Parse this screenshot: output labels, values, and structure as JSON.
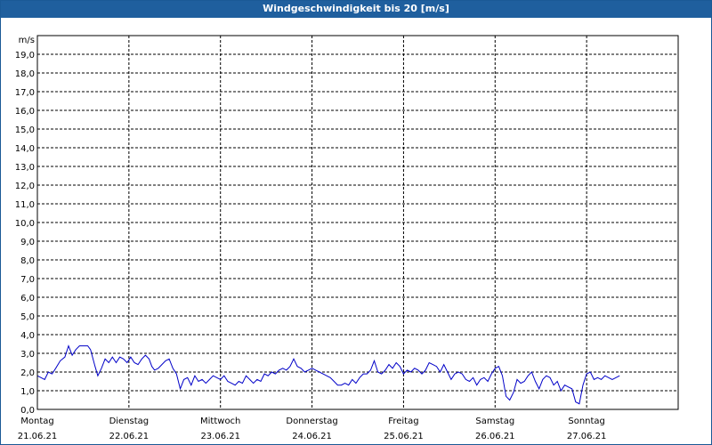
{
  "window": {
    "title": "Windgeschwindigkeit bis 20 [m/s]"
  },
  "colors": {
    "titlebar": "#1f5f9e",
    "series": "#0000c8",
    "grid": "#000000"
  },
  "chart_data": {
    "type": "line",
    "ylabel": "m/s",
    "ylim": [
      0,
      20
    ],
    "yticks": [
      "0,0",
      "1,0",
      "2,0",
      "3,0",
      "4,0",
      "5,0",
      "6,0",
      "7,0",
      "8,0",
      "9,0",
      "10,0",
      "11,0",
      "12,0",
      "13,0",
      "14,0",
      "15,0",
      "16,0",
      "17,0",
      "18,0",
      "19,0"
    ],
    "grid": true,
    "days": [
      {
        "name": "Montag",
        "date": "21.06.21"
      },
      {
        "name": "Dienstag",
        "date": "22.06.21"
      },
      {
        "name": "Mittwoch",
        "date": "23.06.21"
      },
      {
        "name": "Donnerstag",
        "date": "24.06.21"
      },
      {
        "name": "Freitag",
        "date": "25.06.21"
      },
      {
        "name": "Samstag",
        "date": "26.06.21"
      },
      {
        "name": "Sonntag",
        "date": "27.06.21"
      }
    ],
    "x_unit": "days since 21.06.21 00:00",
    "series": [
      {
        "values": [
          [
            0.0,
            1.8
          ],
          [
            0.04,
            1.7
          ],
          [
            0.08,
            1.6
          ],
          [
            0.12,
            2.0
          ],
          [
            0.16,
            1.9
          ],
          [
            0.2,
            2.2
          ],
          [
            0.25,
            2.6
          ],
          [
            0.3,
            2.8
          ],
          [
            0.34,
            3.4
          ],
          [
            0.38,
            2.9
          ],
          [
            0.42,
            3.2
          ],
          [
            0.46,
            3.4
          ],
          [
            0.5,
            3.4
          ],
          [
            0.55,
            3.4
          ],
          [
            0.58,
            3.2
          ],
          [
            0.63,
            2.3
          ],
          [
            0.66,
            1.8
          ],
          [
            0.7,
            2.2
          ],
          [
            0.74,
            2.7
          ],
          [
            0.78,
            2.5
          ],
          [
            0.82,
            2.8
          ],
          [
            0.86,
            2.5
          ],
          [
            0.9,
            2.8
          ],
          [
            0.94,
            2.7
          ],
          [
            0.98,
            2.5
          ],
          [
            1.02,
            2.8
          ],
          [
            1.06,
            2.5
          ],
          [
            1.1,
            2.4
          ],
          [
            1.14,
            2.7
          ],
          [
            1.18,
            2.9
          ],
          [
            1.22,
            2.7
          ],
          [
            1.25,
            2.3
          ],
          [
            1.28,
            2.1
          ],
          [
            1.32,
            2.2
          ],
          [
            1.36,
            2.4
          ],
          [
            1.4,
            2.6
          ],
          [
            1.44,
            2.7
          ],
          [
            1.48,
            2.2
          ],
          [
            1.52,
            1.9
          ],
          [
            1.56,
            1.1
          ],
          [
            1.6,
            1.6
          ],
          [
            1.64,
            1.7
          ],
          [
            1.68,
            1.3
          ],
          [
            1.72,
            1.8
          ],
          [
            1.76,
            1.5
          ],
          [
            1.8,
            1.6
          ],
          [
            1.84,
            1.4
          ],
          [
            1.88,
            1.6
          ],
          [
            1.92,
            1.8
          ],
          [
            1.96,
            1.7
          ],
          [
            2.0,
            1.6
          ],
          [
            2.04,
            1.8
          ],
          [
            2.08,
            1.5
          ],
          [
            2.12,
            1.4
          ],
          [
            2.16,
            1.3
          ],
          [
            2.2,
            1.5
          ],
          [
            2.24,
            1.4
          ],
          [
            2.28,
            1.8
          ],
          [
            2.32,
            1.6
          ],
          [
            2.36,
            1.4
          ],
          [
            2.4,
            1.6
          ],
          [
            2.44,
            1.5
          ],
          [
            2.48,
            1.9
          ],
          [
            2.52,
            1.8
          ],
          [
            2.56,
            2.0
          ],
          [
            2.6,
            1.9
          ],
          [
            2.64,
            2.1
          ],
          [
            2.68,
            2.2
          ],
          [
            2.72,
            2.1
          ],
          [
            2.76,
            2.3
          ],
          [
            2.8,
            2.7
          ],
          [
            2.84,
            2.3
          ],
          [
            2.88,
            2.2
          ],
          [
            2.92,
            2.0
          ],
          [
            2.96,
            2.1
          ],
          [
            3.0,
            2.2
          ],
          [
            3.04,
            2.1
          ],
          [
            3.08,
            2.0
          ],
          [
            3.12,
            1.9
          ],
          [
            3.16,
            1.8
          ],
          [
            3.2,
            1.7
          ],
          [
            3.24,
            1.5
          ],
          [
            3.28,
            1.3
          ],
          [
            3.32,
            1.3
          ],
          [
            3.36,
            1.4
          ],
          [
            3.4,
            1.3
          ],
          [
            3.44,
            1.6
          ],
          [
            3.48,
            1.4
          ],
          [
            3.52,
            1.7
          ],
          [
            3.56,
            1.9
          ],
          [
            3.6,
            1.9
          ],
          [
            3.64,
            2.1
          ],
          [
            3.68,
            2.6
          ],
          [
            3.72,
            2.0
          ],
          [
            3.76,
            1.9
          ],
          [
            3.8,
            2.1
          ],
          [
            3.84,
            2.4
          ],
          [
            3.88,
            2.2
          ],
          [
            3.92,
            2.5
          ],
          [
            3.96,
            2.3
          ],
          [
            4.0,
            1.9
          ],
          [
            4.04,
            2.1
          ],
          [
            4.08,
            2.0
          ],
          [
            4.12,
            2.2
          ],
          [
            4.16,
            2.1
          ],
          [
            4.2,
            1.9
          ],
          [
            4.24,
            2.1
          ],
          [
            4.28,
            2.5
          ],
          [
            4.32,
            2.4
          ],
          [
            4.36,
            2.3
          ],
          [
            4.4,
            2.0
          ],
          [
            4.44,
            2.4
          ],
          [
            4.48,
            2.0
          ],
          [
            4.52,
            1.6
          ],
          [
            4.56,
            1.9
          ],
          [
            4.6,
            2.0
          ],
          [
            4.64,
            1.9
          ],
          [
            4.68,
            1.6
          ],
          [
            4.72,
            1.5
          ],
          [
            4.76,
            1.7
          ],
          [
            4.8,
            1.3
          ],
          [
            4.84,
            1.6
          ],
          [
            4.88,
            1.7
          ],
          [
            4.92,
            1.5
          ],
          [
            4.96,
            1.9
          ],
          [
            5.0,
            2.2
          ],
          [
            5.04,
            2.3
          ],
          [
            5.08,
            1.8
          ],
          [
            5.12,
            0.7
          ],
          [
            5.16,
            0.5
          ],
          [
            5.2,
            0.9
          ],
          [
            5.24,
            1.6
          ],
          [
            5.28,
            1.4
          ],
          [
            5.32,
            1.5
          ],
          [
            5.36,
            1.8
          ],
          [
            5.4,
            2.0
          ],
          [
            5.44,
            1.5
          ],
          [
            5.48,
            1.1
          ],
          [
            5.52,
            1.6
          ],
          [
            5.56,
            1.8
          ],
          [
            5.6,
            1.7
          ],
          [
            5.64,
            1.3
          ],
          [
            5.68,
            1.5
          ],
          [
            5.72,
            1.0
          ],
          [
            5.76,
            1.3
          ],
          [
            5.8,
            1.2
          ],
          [
            5.84,
            1.1
          ],
          [
            5.88,
            0.4
          ],
          [
            5.92,
            0.3
          ],
          [
            5.96,
            1.3
          ],
          [
            6.0,
            1.9
          ],
          [
            6.04,
            2.0
          ],
          [
            6.08,
            1.6
          ],
          [
            6.12,
            1.7
          ],
          [
            6.16,
            1.6
          ],
          [
            6.2,
            1.8
          ],
          [
            6.24,
            1.7
          ],
          [
            6.28,
            1.6
          ],
          [
            6.32,
            1.7
          ],
          [
            6.36,
            1.8
          ]
        ]
      }
    ]
  }
}
